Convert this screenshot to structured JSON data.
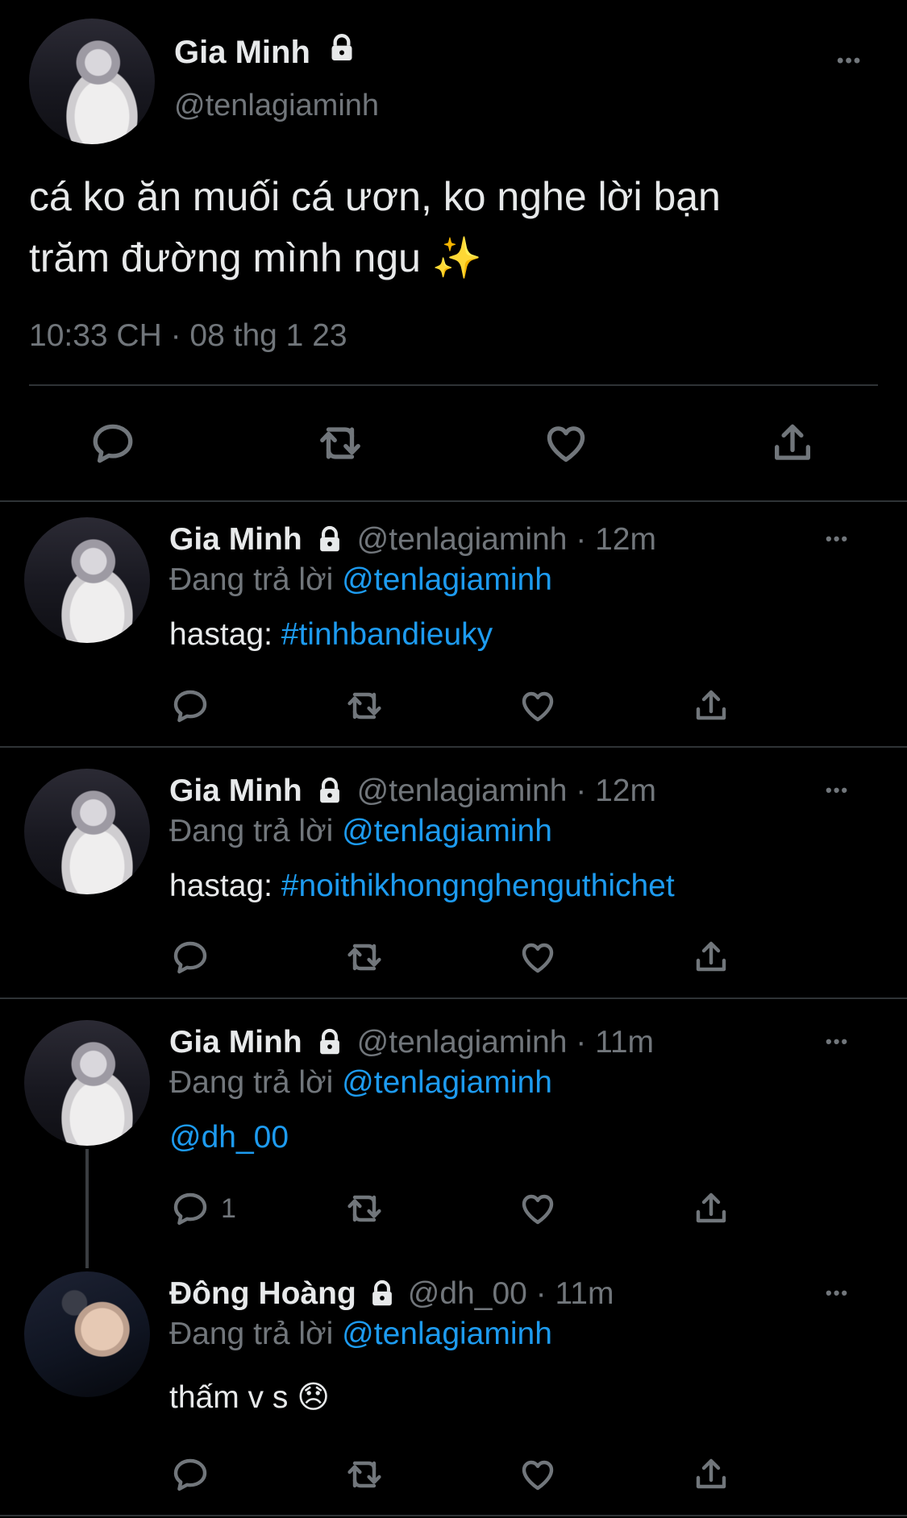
{
  "main": {
    "name": "Gia Minh",
    "handle": "@tenlagiaminh",
    "text_line1": "cá ko ăn muối cá ươn, ko nghe lời bạn",
    "text_line2": "trăm đường mình ngu ✨",
    "meta": "10:33 CH · 08 thg 1 23",
    "more": "•••"
  },
  "replies": [
    {
      "name": "Gia Minh",
      "handle": "@tenlagiaminh · 12m",
      "replying_prefix": "Đang trả lời",
      "replying_to": "@tenlagiaminh",
      "text_prefix": "hastag: ",
      "text_link": "#tinhbandieuky",
      "more": "•••"
    },
    {
      "name": "Gia Minh",
      "handle": "@tenlagiaminh · 12m",
      "replying_prefix": "Đang trả lời",
      "replying_to": "@tenlagiaminh",
      "text_prefix": "hastag: ",
      "text_link": "#noithikhongnghenguthichet",
      "more": "•••"
    },
    {
      "name": "Gia Minh",
      "handle": "@tenlagiaminh · 11m",
      "replying_prefix": "Đang trả lời",
      "replying_to": "@tenlagiaminh",
      "text_link": "@dh_00",
      "reply_count": "1",
      "more": "•••"
    },
    {
      "name": "Đông Hoàng",
      "handle": "@dh_00 · 11m",
      "replying_prefix": "Đang trả lời",
      "replying_to": "@tenlagiaminh",
      "text": "thấm v s 😞",
      "more": "•••"
    }
  ],
  "colors": {
    "background": "#000000",
    "link": "#1d9bf0",
    "muted": "#71767b",
    "divider": "#2f3336"
  },
  "icons": [
    "reply-icon",
    "retweet-icon",
    "like-icon",
    "share-icon",
    "lock-icon",
    "more-icon"
  ]
}
